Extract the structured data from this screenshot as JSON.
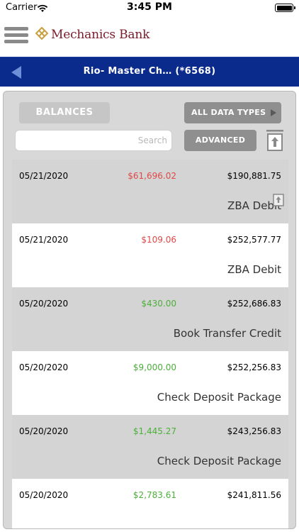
{
  "status": {
    "carrier": "Carrier",
    "time": "3:45 PM"
  },
  "header": {
    "brand": "Mechanics Bank",
    "menu_icon": "hamburger-icon",
    "logo_icon": "mechanics-bank-logo"
  },
  "nav": {
    "title": "Rio- Master Ch…  (*6568)",
    "back_icon": "back-arrow-icon",
    "bar_color": "#0a2a8c"
  },
  "toolbar": {
    "balances_label": "BALANCES",
    "data_types_label": "ALL DATA TYPES",
    "search_placeholder": "Search",
    "advanced_label": "ADVANCED",
    "export_icon": "export-icon"
  },
  "transactions": [
    {
      "date": "05/21/2020",
      "amount": "$61,696.02",
      "type": "debit",
      "balance": "$190,881.75",
      "description": "ZBA Debit",
      "has_icon": true
    },
    {
      "date": "05/21/2020",
      "amount": "$109.06",
      "type": "debit",
      "balance": "$252,577.77",
      "description": "ZBA Debit",
      "has_icon": false
    },
    {
      "date": "05/20/2020",
      "amount": "$430.00",
      "type": "credit",
      "balance": "$252,686.83",
      "description": "Book Transfer Credit",
      "has_icon": false
    },
    {
      "date": "05/20/2020",
      "amount": "$9,000.00",
      "type": "credit",
      "balance": "$252,256.83",
      "description": "Check Deposit Package",
      "has_icon": false
    },
    {
      "date": "05/20/2020",
      "amount": "$1,445.27",
      "type": "credit",
      "balance": "$243,256.83",
      "description": "Check Deposit Package",
      "has_icon": false
    },
    {
      "date": "05/20/2020",
      "amount": "$2,783.61",
      "type": "credit",
      "balance": "$241,811.56",
      "description": "",
      "has_icon": false
    }
  ],
  "colors": {
    "debit": "#e04848",
    "credit": "#4caf3a",
    "brand": "#7a1a2a"
  }
}
